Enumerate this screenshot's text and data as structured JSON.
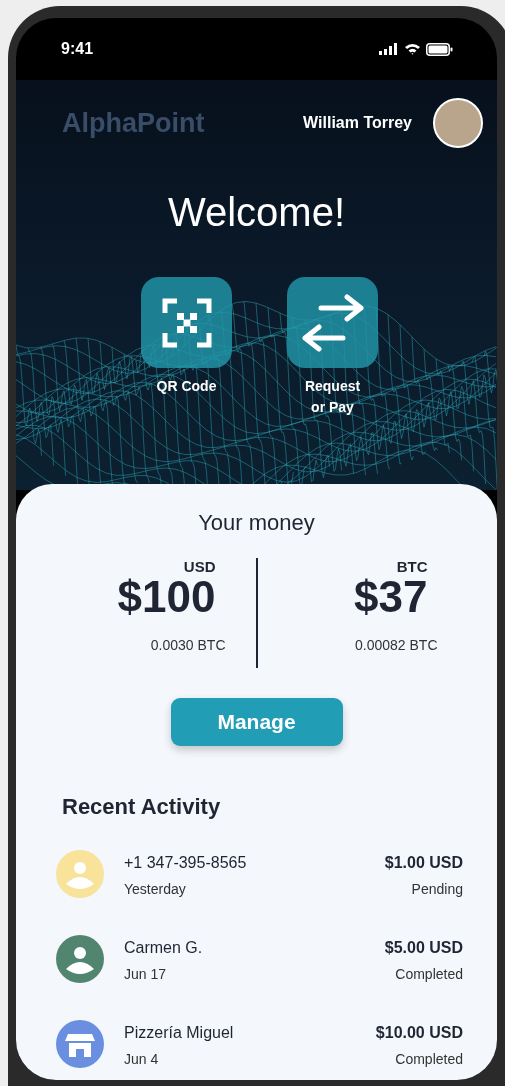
{
  "status_bar": {
    "time": "9:41"
  },
  "header": {
    "logo": "AlphaPoint",
    "user_name": "William Torrey"
  },
  "welcome": "Welcome!",
  "actions": [
    {
      "kind": "qr",
      "label": "QR Code"
    },
    {
      "kind": "transfer",
      "label": "Request or Pay"
    }
  ],
  "balances": {
    "title": "Your money",
    "accounts": [
      {
        "currency": "USD",
        "amount": "$100",
        "equivalent": "0.0030 BTC"
      },
      {
        "currency": "BTC",
        "amount": "$37",
        "equivalent": "0.00082 BTC"
      }
    ],
    "button": "Manage"
  },
  "recent_activity": {
    "title": "Recent Activity",
    "items": [
      {
        "kind": "person",
        "color": "#f9e29a",
        "name": "+1 347-395-8565",
        "date": "Yesterday",
        "amount": "$1.00 USD",
        "status": "Pending"
      },
      {
        "kind": "person",
        "color": "#52856f",
        "name": "Carmen G.",
        "date": "Jun 17",
        "amount": "$5.00 USD",
        "status": "Completed"
      },
      {
        "kind": "store",
        "color": "#6a8ee0",
        "name": "Pizzería Miguel",
        "date": "Jun 4",
        "amount": "$10.00 USD",
        "status": "Completed"
      }
    ]
  }
}
